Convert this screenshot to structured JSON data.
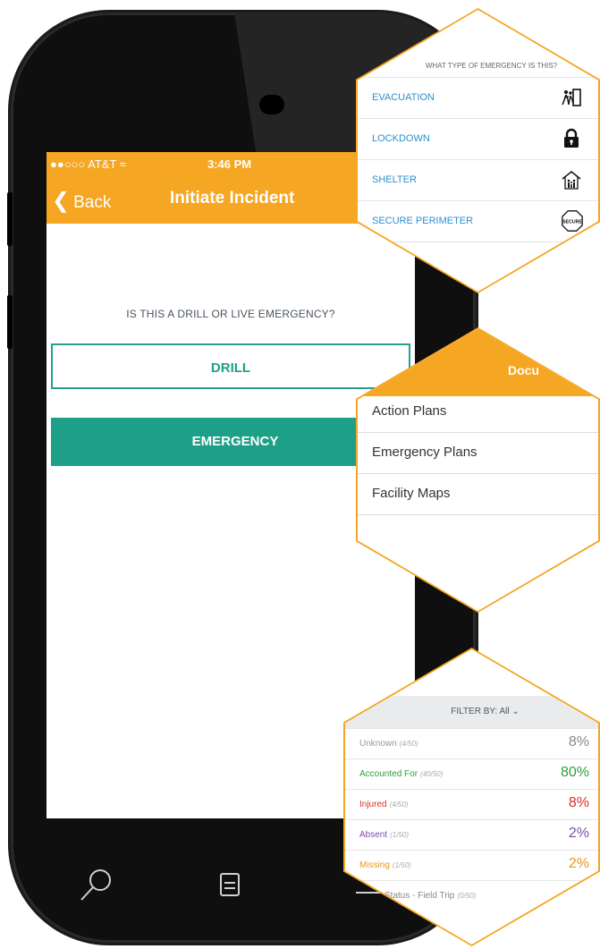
{
  "phone": {
    "status_bar": {
      "carrier": "●●○○○ AT&T ≈",
      "time": "3:46 PM"
    },
    "nav": {
      "back_label": "Back",
      "title": "Initiate Incident"
    },
    "question": "IS THIS A DRILL OR LIVE EMERGENCY?",
    "drill_label": "DRILL",
    "emergency_label": "EMERGENCY",
    "colors": {
      "accent": "#f5a623",
      "primary": "#1e9f88"
    }
  },
  "emergency_types": {
    "header": "WHAT TYPE OF EMERGENCY IS THIS?",
    "items": [
      {
        "label": "EVACUATION",
        "icon": "evacuation-icon"
      },
      {
        "label": "LOCKDOWN",
        "icon": "lock-icon"
      },
      {
        "label": "SHELTER",
        "icon": "shelter-icon"
      },
      {
        "label": "SECURE PERIMETER",
        "icon": "secure-sign-icon",
        "icon_text": "SECURE"
      }
    ]
  },
  "documents": {
    "header": "Docu",
    "items": [
      {
        "label": "Action Plans"
      },
      {
        "label": "Emergency Plans"
      },
      {
        "label": "Facility Maps"
      }
    ]
  },
  "accountability": {
    "filter_label": "FILTER BY: All ⌄",
    "rows": [
      {
        "label": "Unknown",
        "count": "(4/50)",
        "percent": "8%",
        "color": "#999999"
      },
      {
        "label": "Accounted For",
        "count": "(40/50)",
        "percent": "80%",
        "color": "#2e9e3a"
      },
      {
        "label": "Injured",
        "count": "(4/50)",
        "percent": "8%",
        "color": "#d6302a"
      },
      {
        "label": "Absent",
        "count": "(1/50)",
        "percent": "2%",
        "color": "#7b4fa8"
      },
      {
        "label": "Missing",
        "count": "(1/50)",
        "percent": "2%",
        "color": "#e39a18"
      },
      {
        "label": "Status - Field Trip",
        "count": "(0/50)",
        "percent": "",
        "color": "#888888"
      }
    ]
  }
}
